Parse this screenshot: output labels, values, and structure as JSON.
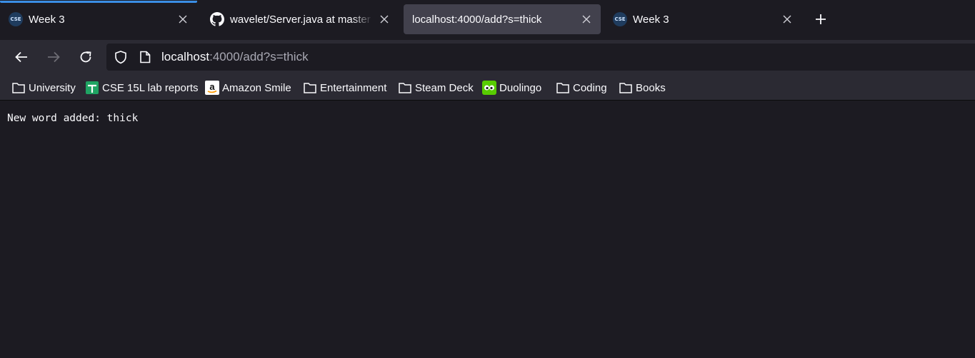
{
  "tabs": [
    {
      "title": "Week 3",
      "favicon": "cse-icon",
      "favicon_text": "CSE",
      "selected": false,
      "loading_bar": true
    },
    {
      "title": "wavelet/Server.java at master · a",
      "favicon": "github-icon",
      "selected": false
    },
    {
      "title": "localhost:4000/add?s=thick",
      "favicon": "",
      "selected": true
    },
    {
      "title": "Week 3",
      "favicon": "cse-icon",
      "favicon_text": "CSE",
      "selected": false
    }
  ],
  "urlbar": {
    "host": "localhost",
    "rest": ":4000/add?s=thick"
  },
  "bookmarks": [
    {
      "label": "University",
      "icon": "folder-icon"
    },
    {
      "label": "CSE 15L lab reports",
      "icon": "google-sheets-icon"
    },
    {
      "label": "Amazon Smile",
      "icon": "amazon-icon"
    },
    {
      "label": "Entertainment",
      "icon": "folder-icon"
    },
    {
      "label": "Steam Deck",
      "icon": "folder-icon"
    },
    {
      "label": "Duolingo",
      "icon": "duolingo-icon"
    },
    {
      "label": "Coding",
      "icon": "folder-icon"
    },
    {
      "label": "Books",
      "icon": "folder-icon"
    }
  ],
  "page": {
    "body_text": "New word added: thick"
  },
  "colors": {
    "accent": "#3a8ee6",
    "background": "#1c1b22",
    "toolbar": "#2b2a33",
    "selected_tab": "#42414d"
  }
}
